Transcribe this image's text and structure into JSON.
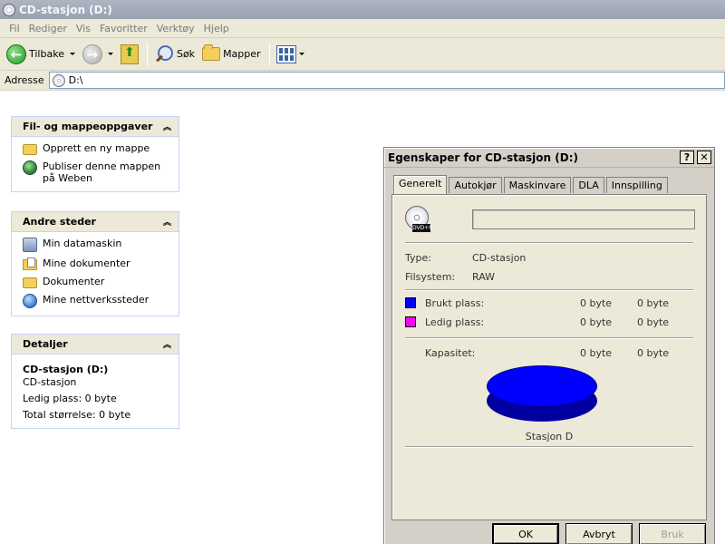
{
  "window": {
    "title": "CD-stasjon (D:)"
  },
  "menu": [
    "Fil",
    "Rediger",
    "Vis",
    "Favoritter",
    "Verktøy",
    "Hjelp"
  ],
  "toolbar": {
    "back": "Tilbake",
    "search": "Søk",
    "folders": "Mapper"
  },
  "address": {
    "label": "Adresse",
    "value": "D:\\"
  },
  "tasks_panel": {
    "title": "Fil- og mappeoppgaver",
    "items": [
      "Opprett en ny mappe",
      "Publiser denne mappen på Weben"
    ]
  },
  "places_panel": {
    "title": "Andre steder",
    "items": [
      "Min datamaskin",
      "Mine dokumenter",
      "Dokumenter",
      "Mine nettverkssteder"
    ]
  },
  "details_panel": {
    "title": "Detaljer",
    "name": "CD-stasjon (D:)",
    "type": "CD-stasjon",
    "free": "Ledig plass: 0 byte",
    "total": "Total størrelse: 0 byte"
  },
  "dialog": {
    "title": "Egenskaper for CD-stasjon (D:)",
    "help_btn": "?",
    "close_btn": "✕",
    "tabs": [
      "Generelt",
      "Autokjør",
      "Maskinvare",
      "DLA",
      "Innspilling"
    ],
    "dvd_badge": "DVD+R",
    "type_label": "Type:",
    "type_value": "CD-stasjon",
    "fs_label": "Filsystem:",
    "fs_value": "RAW",
    "used_label": "Brukt plass:",
    "used_bytes": "0 byte",
    "used_size": "0 byte",
    "free_label": "Ledig plass:",
    "free_bytes": "0 byte",
    "free_size": "0 byte",
    "cap_label": "Kapasitet:",
    "cap_bytes": "0 byte",
    "cap_size": "0 byte",
    "drive_label": "Stasjon D",
    "ok": "OK",
    "cancel": "Avbryt",
    "apply": "Bruk",
    "colors": {
      "used": "#0000ff",
      "free": "#ff00ff"
    }
  }
}
